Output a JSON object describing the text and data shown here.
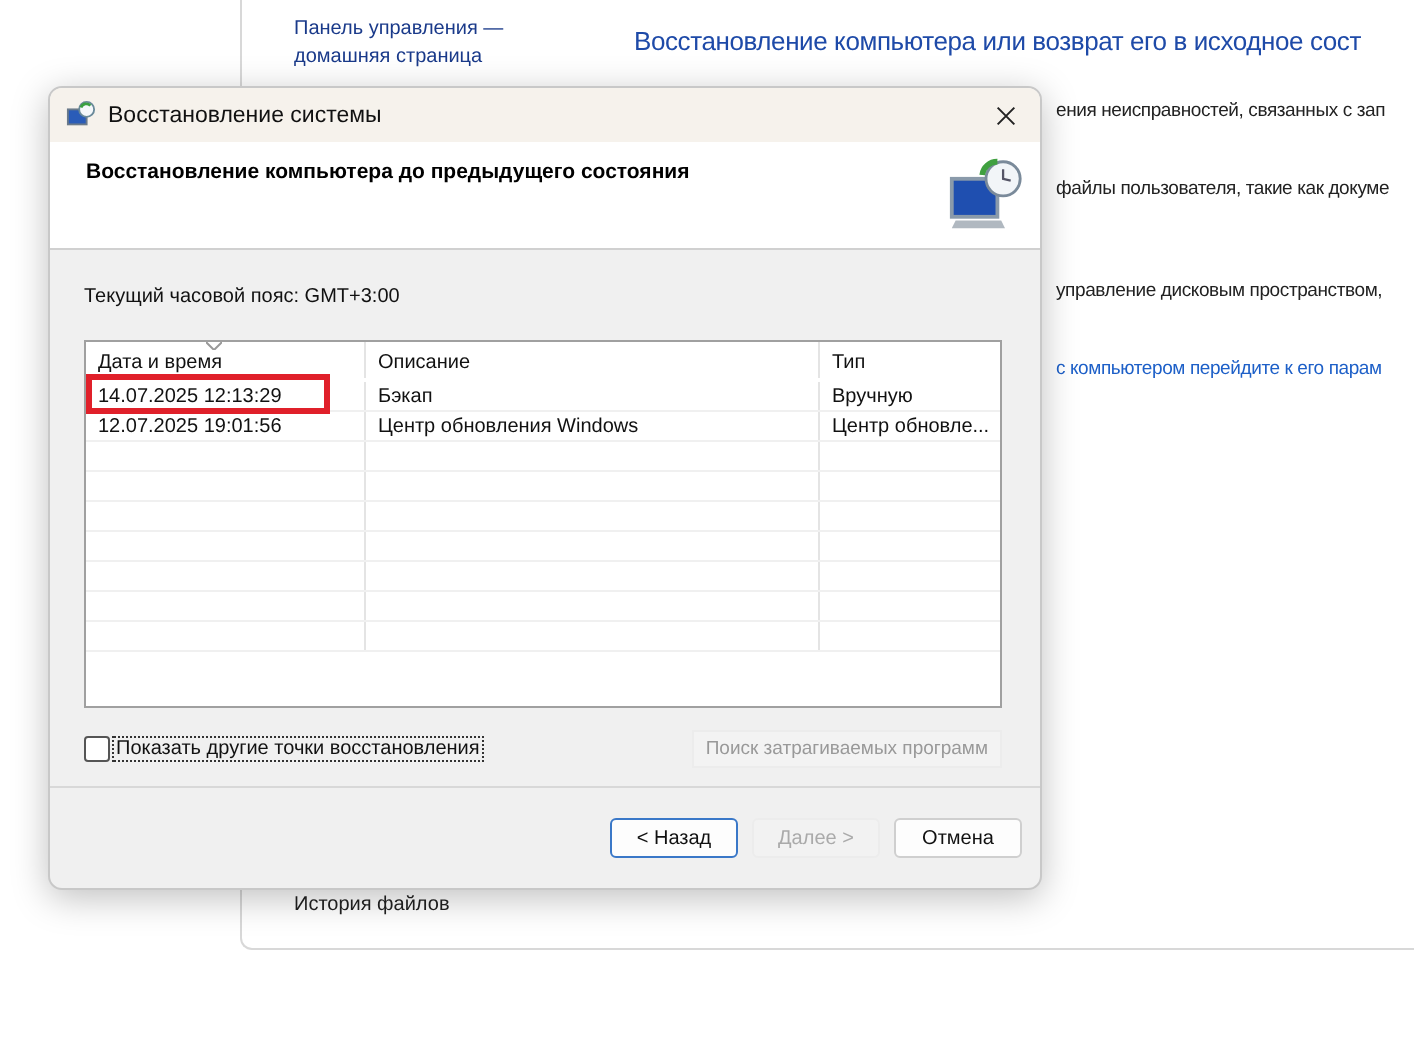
{
  "background_window": {
    "home_link": "Панель управления — домашняя страница",
    "heading": "Восстановление компьютера или возврат его в исходное сост",
    "lines": [
      {
        "kind": "text",
        "text": "ения неисправностей, связанных с зап"
      },
      {
        "kind": "text",
        "text": "файлы пользователя, такие как докуме"
      },
      {
        "kind": "text",
        "text": "управление дисковым пространством,"
      },
      {
        "kind": "link",
        "text": "с компьютером перейдите к его парам"
      }
    ],
    "bottom_item": "История файлов"
  },
  "dialog": {
    "title": "Восстановление системы",
    "header": "Восстановление компьютера до предыдущего состояния",
    "timezone": "Текущий часовой пояс: GMT+3:00",
    "table": {
      "columns": [
        "Дата и время",
        "Описание",
        "Тип"
      ],
      "rows": [
        {
          "date": "14.07.2025 12:13:29",
          "description": "Бэкап",
          "type": "Вручную",
          "highlighted": true
        },
        {
          "date": "12.07.2025 19:01:56",
          "description": "Центр обновления Windows",
          "type": "Центр обновле...",
          "highlighted": false
        }
      ]
    },
    "show_more": {
      "label": "Показать другие точки восстановления",
      "checked": false
    },
    "scan_button": {
      "label": "Поиск затрагиваемых программ",
      "disabled": true
    },
    "buttons": [
      {
        "label": "< Назад",
        "disabled": false,
        "default": true
      },
      {
        "label": "Далее >",
        "disabled": true,
        "default": false
      },
      {
        "label": "Отмена",
        "disabled": false,
        "default": false
      }
    ]
  }
}
